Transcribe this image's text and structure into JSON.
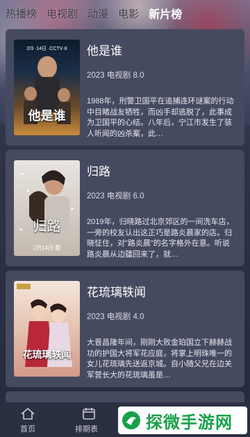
{
  "tabs": [
    {
      "label": "热播榜"
    },
    {
      "label": "电视剧"
    },
    {
      "label": "动漫"
    },
    {
      "label": "电影"
    },
    {
      "label": "新片榜"
    }
  ],
  "cards": [
    {
      "title": "他是谁",
      "meta": "2023 电视剧 8.0",
      "description": "1988年，刑警卫国平在追捕连环谜案的行动中目睹战友牺牲，而凶手却逃脱了，此事成为卫国平的心结。八年后，宁江市发生了骇人听闻的凶杀案，此…",
      "poster_title": "他是谁",
      "poster_date": "2/3 ·14日 ·CCTV·8"
    },
    {
      "title": "归路",
      "meta": "2023 电视剧 6.0",
      "description": "2019年，归晓路过北京郊区的一间洗车店，一旁的校友认出这正巧是路炎晨家的店。归晓怔住，对\"路炎晨\"的名字格外在意。听说路炎晨从边疆回来了，就…",
      "poster_title": "归路",
      "poster_date": "2月14日 都"
    },
    {
      "title": "花琉璃轶闻",
      "meta": "2023 电视剧 4.0",
      "description": "大晋昌隆年间，刚刚大败金珀国立下赫赫战功的护国大将军花应庭，将掌上明珠唯一的女儿花琉璃先送返京城。自小随父兄在边关军营长大的花琉璃虽是…",
      "poster_title": "花琉璃轶闻",
      "poster_date": ""
    }
  ],
  "nav": [
    {
      "label": "首页",
      "icon": "home-icon"
    },
    {
      "label": "排期表",
      "icon": "calendar-icon"
    }
  ],
  "watermark": {
    "text": "探微手游网"
  },
  "colors": {
    "card_bg": "#464a60",
    "nav_bg": "#2b2f42",
    "watermark_green": "#18a14a"
  }
}
